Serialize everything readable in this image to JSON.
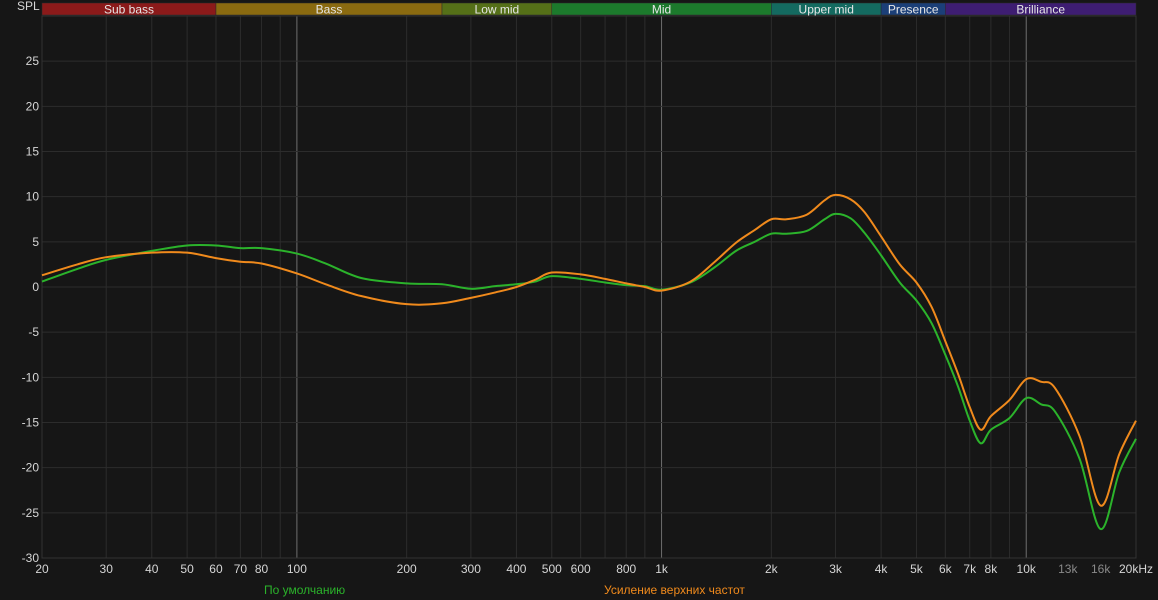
{
  "chart_data": {
    "type": "line",
    "ylabel": "SPL",
    "x_unit_label": "20kHz",
    "x_scale": "log",
    "xlim": [
      20,
      20000
    ],
    "ylim": [
      -30,
      30
    ],
    "grid": true,
    "y_ticks": [
      25,
      20,
      15,
      10,
      5,
      0,
      -5,
      -10,
      -15,
      -20,
      -25,
      -30
    ],
    "x_ticks": [
      {
        "v": 20,
        "label": "20"
      },
      {
        "v": 30,
        "label": "30"
      },
      {
        "v": 40,
        "label": "40"
      },
      {
        "v": 50,
        "label": "50"
      },
      {
        "v": 60,
        "label": "60"
      },
      {
        "v": 70,
        "label": "70"
      },
      {
        "v": 80,
        "label": "80"
      },
      {
        "v": 100,
        "label": "100"
      },
      {
        "v": 200,
        "label": "200"
      },
      {
        "v": 300,
        "label": "300"
      },
      {
        "v": 400,
        "label": "400"
      },
      {
        "v": 500,
        "label": "500"
      },
      {
        "v": 600,
        "label": "600"
      },
      {
        "v": 800,
        "label": "800"
      },
      {
        "v": 1000,
        "label": "1k"
      },
      {
        "v": 2000,
        "label": "2k"
      },
      {
        "v": 3000,
        "label": "3k"
      },
      {
        "v": 4000,
        "label": "4k"
      },
      {
        "v": 5000,
        "label": "5k"
      },
      {
        "v": 6000,
        "label": "6k"
      },
      {
        "v": 7000,
        "label": "7k"
      },
      {
        "v": 8000,
        "label": "8k"
      },
      {
        "v": 10000,
        "label": "10k"
      },
      {
        "v": 13000,
        "label": "13k",
        "dim": true
      },
      {
        "v": 16000,
        "label": "16k",
        "dim": true
      },
      {
        "v": 20000,
        "label": "20kHz"
      }
    ],
    "major_lines": [
      100,
      1000,
      10000
    ],
    "bands": [
      {
        "name": "Sub bass",
        "from": 20,
        "to": 60,
        "color": "#8b1a1a"
      },
      {
        "name": "Bass",
        "from": 60,
        "to": 250,
        "color": "#8a6a10"
      },
      {
        "name": "Low mid",
        "from": 250,
        "to": 500,
        "color": "#557018"
      },
      {
        "name": "Mid",
        "from": 500,
        "to": 2000,
        "color": "#1c7a2c"
      },
      {
        "name": "Upper mid",
        "from": 2000,
        "to": 4000,
        "color": "#146a60"
      },
      {
        "name": "Presence",
        "from": 4000,
        "to": 6000,
        "color": "#1b3f78"
      },
      {
        "name": "Brilliance",
        "from": 6000,
        "to": 20000,
        "color": "#3e1d72"
      }
    ],
    "series": [
      {
        "name": "По умолчанию",
        "color": "#2bb32b",
        "points": [
          [
            20,
            0.6
          ],
          [
            25,
            2.0
          ],
          [
            30,
            3.0
          ],
          [
            40,
            4.0
          ],
          [
            50,
            4.6
          ],
          [
            60,
            4.6
          ],
          [
            70,
            4.3
          ],
          [
            80,
            4.3
          ],
          [
            100,
            3.7
          ],
          [
            120,
            2.6
          ],
          [
            150,
            1.0
          ],
          [
            200,
            0.4
          ],
          [
            250,
            0.3
          ],
          [
            300,
            -0.2
          ],
          [
            350,
            0.1
          ],
          [
            400,
            0.3
          ],
          [
            450,
            0.6
          ],
          [
            500,
            1.2
          ],
          [
            600,
            0.9
          ],
          [
            700,
            0.5
          ],
          [
            800,
            0.2
          ],
          [
            900,
            0.1
          ],
          [
            1000,
            -0.3
          ],
          [
            1200,
            0.5
          ],
          [
            1400,
            2.2
          ],
          [
            1600,
            4.0
          ],
          [
            1800,
            5.0
          ],
          [
            2000,
            5.9
          ],
          [
            2200,
            5.9
          ],
          [
            2500,
            6.2
          ],
          [
            2800,
            7.5
          ],
          [
            3000,
            8.1
          ],
          [
            3300,
            7.6
          ],
          [
            3600,
            6.0
          ],
          [
            4000,
            3.5
          ],
          [
            4500,
            0.5
          ],
          [
            5000,
            -1.5
          ],
          [
            5500,
            -4.0
          ],
          [
            6000,
            -7.5
          ],
          [
            6500,
            -11.0
          ],
          [
            7000,
            -14.8
          ],
          [
            7500,
            -17.3
          ],
          [
            8000,
            -15.8
          ],
          [
            9000,
            -14.5
          ],
          [
            10000,
            -12.3
          ],
          [
            11000,
            -13.0
          ],
          [
            12000,
            -13.8
          ],
          [
            14000,
            -19.0
          ],
          [
            16000,
            -26.8
          ],
          [
            18000,
            -20.5
          ],
          [
            20000,
            -16.8
          ]
        ]
      },
      {
        "name": "Усиление верхних частот",
        "color": "#f08a1c",
        "points": [
          [
            20,
            1.3
          ],
          [
            25,
            2.5
          ],
          [
            30,
            3.3
          ],
          [
            40,
            3.8
          ],
          [
            50,
            3.8
          ],
          [
            60,
            3.2
          ],
          [
            70,
            2.8
          ],
          [
            80,
            2.6
          ],
          [
            100,
            1.5
          ],
          [
            120,
            0.3
          ],
          [
            150,
            -1.0
          ],
          [
            200,
            -1.9
          ],
          [
            250,
            -1.8
          ],
          [
            300,
            -1.2
          ],
          [
            350,
            -0.6
          ],
          [
            400,
            0.0
          ],
          [
            450,
            0.8
          ],
          [
            500,
            1.6
          ],
          [
            600,
            1.4
          ],
          [
            700,
            0.9
          ],
          [
            800,
            0.4
          ],
          [
            900,
            0.0
          ],
          [
            1000,
            -0.4
          ],
          [
            1200,
            0.6
          ],
          [
            1400,
            2.8
          ],
          [
            1600,
            4.9
          ],
          [
            1800,
            6.3
          ],
          [
            2000,
            7.5
          ],
          [
            2200,
            7.5
          ],
          [
            2500,
            8.0
          ],
          [
            2800,
            9.6
          ],
          [
            3000,
            10.2
          ],
          [
            3300,
            9.7
          ],
          [
            3600,
            8.3
          ],
          [
            4000,
            5.6
          ],
          [
            4500,
            2.5
          ],
          [
            5000,
            0.5
          ],
          [
            5500,
            -2.2
          ],
          [
            6000,
            -6.0
          ],
          [
            6500,
            -9.6
          ],
          [
            7000,
            -13.3
          ],
          [
            7500,
            -15.8
          ],
          [
            8000,
            -14.3
          ],
          [
            9000,
            -12.5
          ],
          [
            10000,
            -10.2
          ],
          [
            11000,
            -10.5
          ],
          [
            12000,
            -11.2
          ],
          [
            14000,
            -16.5
          ],
          [
            16000,
            -24.2
          ],
          [
            18000,
            -18.5
          ],
          [
            20000,
            -14.8
          ]
        ]
      }
    ]
  }
}
